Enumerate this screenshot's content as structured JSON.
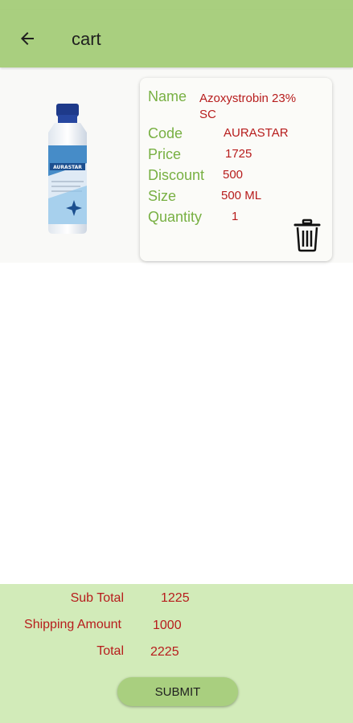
{
  "app_bar": {
    "title": "cart",
    "back_icon": "arrow-left-icon"
  },
  "colors": {
    "primary": "#a9cf7f",
    "label_green": "#78b043",
    "value_red": "#b71c1c",
    "summary_bg": "#d2ebb9"
  },
  "cart_item": {
    "image_brand_text": "AURASTAR",
    "labels": {
      "name": "Name",
      "code": "Code",
      "price": "Price",
      "discount": "Discount",
      "size": "Size",
      "quantity": "Quantity"
    },
    "values": {
      "name_line1": "Azoxystrobin 23%",
      "name_line2": "SC",
      "code": "AURASTAR",
      "price": "1725",
      "discount": "500",
      "size": "500 ML",
      "quantity": "1"
    },
    "delete_icon": "trash-icon"
  },
  "summary": {
    "sub_total_label": "Sub Total",
    "sub_total_value": "1225",
    "shipping_label": "Shipping Amount",
    "shipping_value": "1000",
    "total_label": "Total",
    "total_value": "2225",
    "submit_label": "SUBMIT"
  }
}
